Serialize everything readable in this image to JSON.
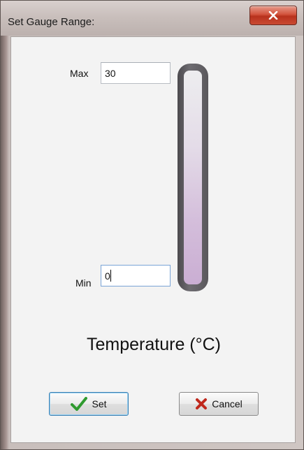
{
  "dialog": {
    "title": "Set Gauge Range:",
    "close_icon": "close-icon"
  },
  "range": {
    "max_label": "Max",
    "max_value": "30",
    "min_label": "Min",
    "min_value": "0"
  },
  "gauge": {
    "label": "Temperature (°C)",
    "level_fraction": 0,
    "colors": {
      "frame": "#5b595d",
      "fill_top": "#ededef",
      "fill_bottom": "#caaed3"
    }
  },
  "buttons": {
    "set_label": "Set",
    "set_icon": "checkmark-icon",
    "cancel_label": "Cancel",
    "cancel_icon": "x-icon"
  },
  "colors": {
    "close_button": "#c94a33",
    "check": "#2f9a2f",
    "cancel_x": "#c0281c"
  }
}
